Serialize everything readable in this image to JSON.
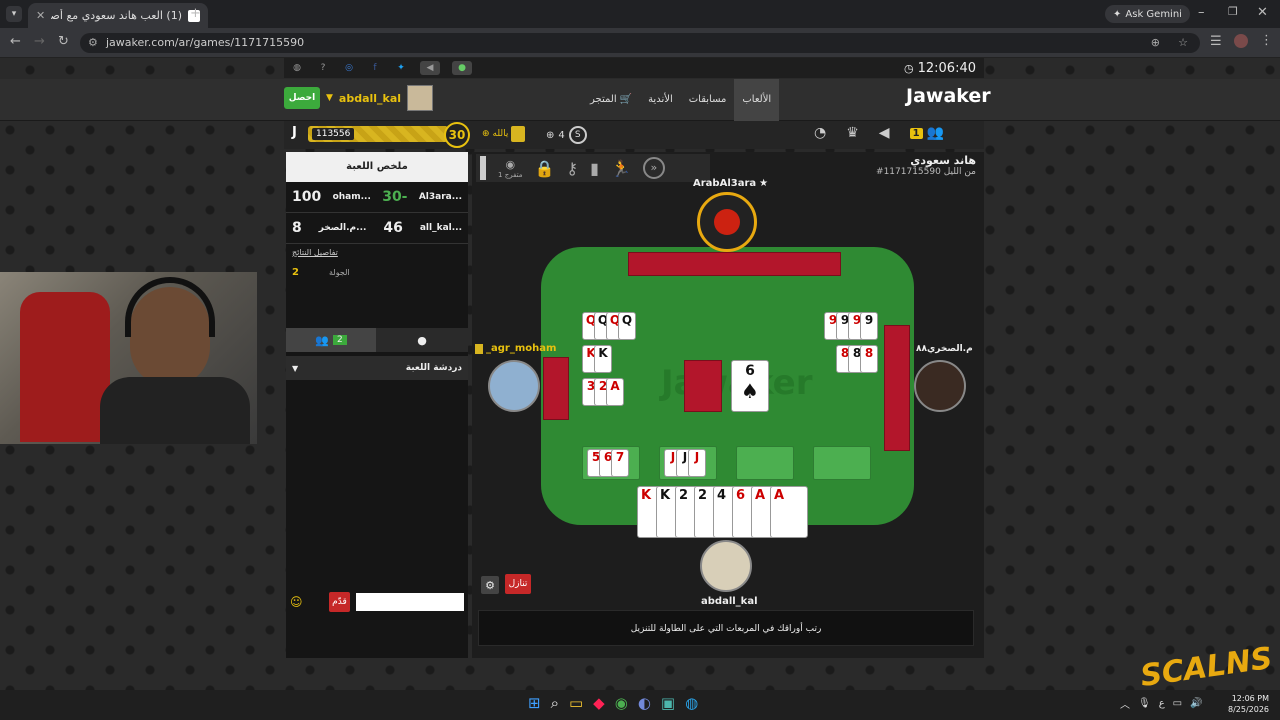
{
  "browser": {
    "tab_title": "(1) العب هاند سعودي مع أصدقائك",
    "url": "jawaker.com/ar/games/1171715590",
    "gemini": "Ask Gemini"
  },
  "clock": "12:06:40",
  "nav": {
    "brand": "Jawaker",
    "items": [
      "الألعاب",
      "مسابقات",
      "الأندية",
      "المتجر"
    ],
    "user": "abdall_kal",
    "get_btn": "احصل"
  },
  "toolbar": {
    "coins": "113556",
    "level": "30",
    "paid": "يالله",
    "players": "4",
    "badge": "1"
  },
  "game": {
    "title": "هاند سعودي",
    "id": "#1171715590 من الليل",
    "spectators": "1 متفرج"
  },
  "summary": {
    "title": "ملخص اللعبة",
    "row1": {
      "s1": "100",
      "n1": "oham...",
      "mid": "30-",
      "n2": "Al3ara..."
    },
    "row2": {
      "s1": "8",
      "n1": "م.الصخر...",
      "mid": "46",
      "n2": "all_kal..."
    },
    "details": "تفاصيل النتائج",
    "round_label": "الجولة",
    "round_value": "2"
  },
  "chat": {
    "count": "2",
    "title": "دردشة اللعبة",
    "send": "قدّم"
  },
  "players": {
    "top": "ArabAl3ara",
    "left": "_agr_moham",
    "right": "م.الصخري٨٨",
    "bottom": "abdall_kal"
  },
  "hint": "رتب أوراقك في المربعات التي على الطاولة للتنزيل",
  "btn_red": "تنازل",
  "logo_text": "Jawaker",
  "played_card": "6",
  "melds": {
    "left_top": [
      "Q",
      "Q",
      "Q",
      "Q"
    ],
    "left_mid": [
      "K",
      "K"
    ],
    "left_bot": [
      "3",
      "2",
      "A"
    ],
    "right_top": [
      "9",
      "9",
      "9",
      "9"
    ],
    "right_mid": [
      "8",
      "8",
      "8"
    ],
    "table1": [
      "5",
      "6",
      "7"
    ],
    "table2": [
      "J",
      "J",
      "J"
    ]
  },
  "hand": [
    {
      "r": "K",
      "c": "red"
    },
    {
      "r": "K",
      "c": "black"
    },
    {
      "r": "2",
      "c": "black"
    },
    {
      "r": "2",
      "c": "black"
    },
    {
      "r": "4",
      "c": "black"
    },
    {
      "r": "6",
      "c": "red"
    },
    {
      "r": "A",
      "c": "red"
    },
    {
      "r": "A",
      "c": "red"
    }
  ],
  "taskbar": {
    "time": "12:06 PM",
    "date": "8/25/2026"
  },
  "watermark": "SCALNS"
}
